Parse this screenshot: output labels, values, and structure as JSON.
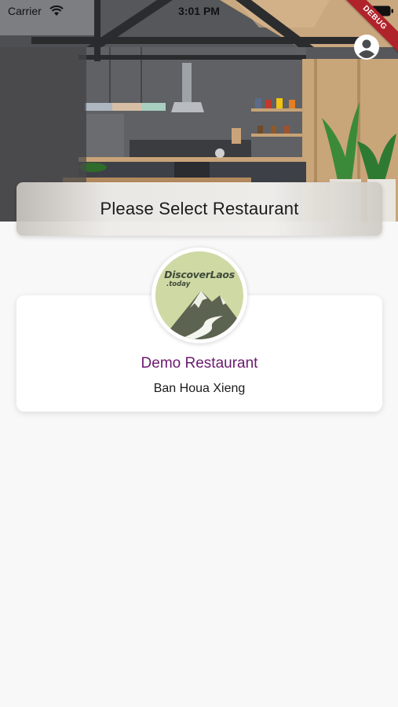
{
  "status_bar": {
    "carrier": "Carrier",
    "time": "3:01 PM"
  },
  "debug_banner": {
    "label": "DEBUG",
    "color": "#b0232b"
  },
  "header": {
    "title": "Please Select Restaurant",
    "profile_icon": "account-circle-icon"
  },
  "restaurants": [
    {
      "name": "Demo Restaurant",
      "address": "Ban Houa Xieng",
      "logo": {
        "brand": "DiscoverLaos",
        "sub": ".today",
        "background": "#cfd9a4"
      }
    }
  ],
  "colors": {
    "name_accent": "#6b1a6e",
    "page_background": "#f8f8f8"
  }
}
